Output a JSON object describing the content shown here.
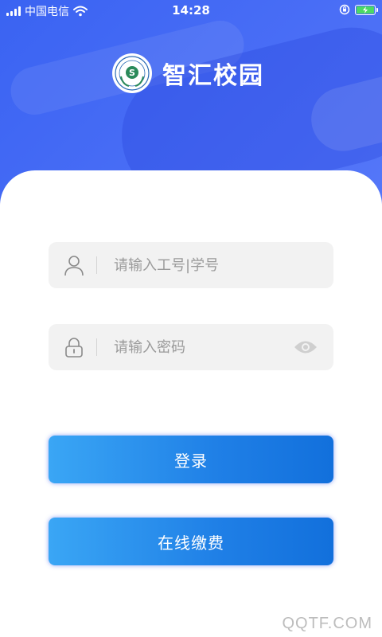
{
  "status_bar": {
    "carrier": "中国电信",
    "time": "14:28"
  },
  "brand": {
    "title": "智汇校园"
  },
  "login_form": {
    "username_placeholder": "请输入工号|学号",
    "password_placeholder": "请输入密码"
  },
  "buttons": {
    "login_label": "登录",
    "pay_label": "在线缴费"
  },
  "colors": {
    "header_blue": "#4169f5",
    "button_start": "#3aa6f5",
    "button_end": "#1270dc",
    "field_bg": "#f2f2f2"
  },
  "watermark": "QQTF.COM"
}
